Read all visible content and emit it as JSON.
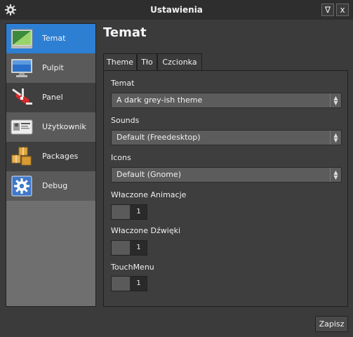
{
  "window": {
    "title": "Ustawienia",
    "minimize_glyph": "∇",
    "close_glyph": "x"
  },
  "sidebar": {
    "items": [
      {
        "label": "Temat",
        "icon": "theme-icon",
        "active": true
      },
      {
        "label": "Pulpit",
        "icon": "monitor-icon"
      },
      {
        "label": "Panel",
        "icon": "swiss-knife-icon"
      },
      {
        "label": "Użytkownik",
        "icon": "user-card-icon"
      },
      {
        "label": "Packages",
        "icon": "packages-icon"
      },
      {
        "label": "Debug",
        "icon": "gear-icon"
      }
    ]
  },
  "main": {
    "heading": "Temat",
    "tabs": [
      {
        "label": "Theme",
        "active": true
      },
      {
        "label": "Tło"
      },
      {
        "label": "Czcionka"
      }
    ],
    "fields": {
      "temat": {
        "label": "Temat",
        "value": "A dark grey-ish theme"
      },
      "sounds": {
        "label": "Sounds",
        "value": "Default (Freedesktop)"
      },
      "icons": {
        "label": "Icons",
        "value": "Default (Gnome)"
      },
      "animacje": {
        "label": "Właczone Animacje",
        "value": "1"
      },
      "dzwieki": {
        "label": "Właczone Dźwięki",
        "value": "1"
      },
      "touchmenu": {
        "label": "TouchMenu",
        "value": "1"
      }
    }
  },
  "footer": {
    "save_label": "Zapisz"
  },
  "colors": {
    "accent": "#2d7fd3",
    "background": "#3b3b3b",
    "sidebar": "#6f6f6f"
  }
}
